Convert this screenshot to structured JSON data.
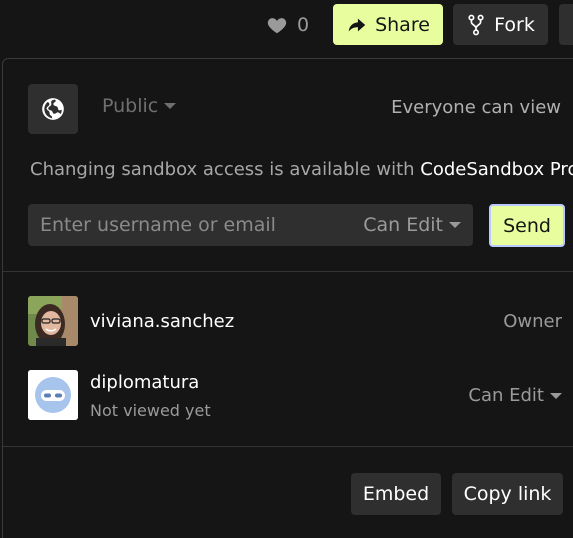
{
  "topbar": {
    "like_count": "0",
    "share_label": "Share",
    "fork_label": "Fork"
  },
  "access": {
    "visibility": "Public",
    "visibility_note": "Everyone can view",
    "pro_note_prefix": "Changing sandbox access is available with ",
    "pro_note_brand": "CodeSandbox Pro"
  },
  "invite": {
    "placeholder": "Enter username or email",
    "permission": "Can Edit",
    "send_label": "Send"
  },
  "members": [
    {
      "name": "viviana.sanchez",
      "subtitle": "",
      "role": "Owner"
    },
    {
      "name": "diplomatura",
      "subtitle": "Not viewed yet",
      "role": "Can Edit"
    }
  ],
  "footer": {
    "embed_label": "Embed",
    "copy_link_label": "Copy link"
  },
  "icons": {
    "like": "heart-icon",
    "share": "share-arrow-icon",
    "fork": "fork-icon",
    "globe": "globe-icon",
    "caret": "chevron-down-icon"
  },
  "colors": {
    "accent": "#e8fe9e",
    "background": "#151515",
    "surface": "#2f2f2f"
  }
}
